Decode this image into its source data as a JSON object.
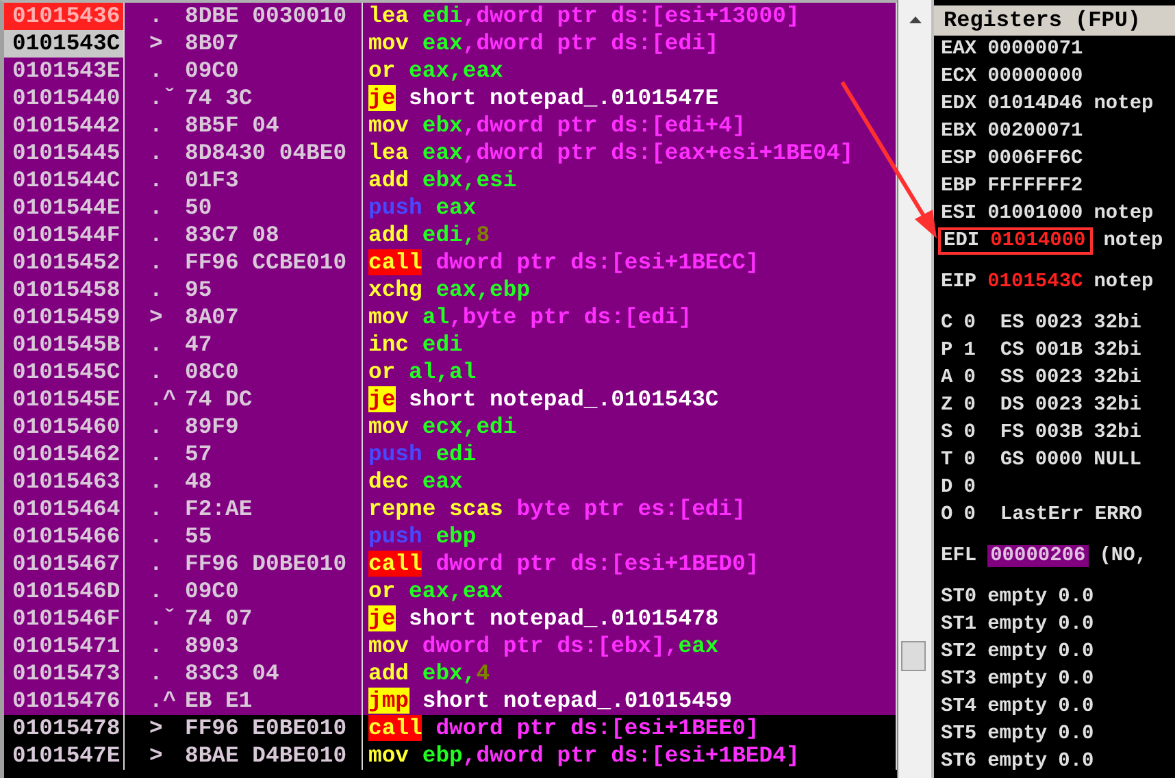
{
  "disassembly": {
    "rows": [
      {
        "address": "01015436",
        "breakpoint": true,
        "eip": false,
        "selected": true,
        "marker": ".",
        "hex": "8DBE 0030010",
        "mnemonic": {
          "text": "lea",
          "kind": "plain"
        },
        "operands": [
          {
            "text": "edi",
            "kind": "register"
          },
          {
            "text": ",dword ptr ds:[esi+13000]",
            "kind": "memory"
          }
        ]
      },
      {
        "address": "0101543C",
        "breakpoint": false,
        "eip": true,
        "selected": true,
        "marker": ">",
        "hex": "8B07",
        "mnemonic": {
          "text": "mov",
          "kind": "plain"
        },
        "operands": [
          {
            "text": "eax",
            "kind": "register"
          },
          {
            "text": ",dword ptr ds:[edi]",
            "kind": "memory"
          }
        ]
      },
      {
        "address": "0101543E",
        "breakpoint": false,
        "eip": false,
        "selected": true,
        "marker": ".",
        "hex": "09C0",
        "mnemonic": {
          "text": "or",
          "kind": "plain"
        },
        "operands": [
          {
            "text": "eax,eax",
            "kind": "register"
          }
        ]
      },
      {
        "address": "01015440",
        "breakpoint": false,
        "eip": false,
        "selected": true,
        "marker": ".ˇ",
        "hex": "74 3C",
        "mnemonic": {
          "text": "je",
          "kind": "jump"
        },
        "operands": [
          {
            "text": "short notepad_.0101547E",
            "kind": "label"
          }
        ]
      },
      {
        "address": "01015442",
        "breakpoint": false,
        "eip": false,
        "selected": true,
        "marker": ".",
        "hex": "8B5F 04",
        "mnemonic": {
          "text": "mov",
          "kind": "plain"
        },
        "operands": [
          {
            "text": "ebx",
            "kind": "register"
          },
          {
            "text": ",dword ptr ds:[edi+4]",
            "kind": "memory"
          }
        ]
      },
      {
        "address": "01015445",
        "breakpoint": false,
        "eip": false,
        "selected": true,
        "marker": ".",
        "hex": "8D8430 04BE0",
        "mnemonic": {
          "text": "lea",
          "kind": "plain"
        },
        "operands": [
          {
            "text": "eax",
            "kind": "register"
          },
          {
            "text": ",dword ptr ds:[eax+esi+1BE04]",
            "kind": "memory"
          }
        ]
      },
      {
        "address": "0101544C",
        "breakpoint": false,
        "eip": false,
        "selected": true,
        "marker": ".",
        "hex": "01F3",
        "mnemonic": {
          "text": "add",
          "kind": "plain"
        },
        "operands": [
          {
            "text": "ebx,esi",
            "kind": "register"
          }
        ]
      },
      {
        "address": "0101544E",
        "breakpoint": false,
        "eip": false,
        "selected": true,
        "marker": ".",
        "hex": "50",
        "mnemonic": {
          "text": "push",
          "kind": "push"
        },
        "operands": [
          {
            "text": "eax",
            "kind": "register"
          }
        ]
      },
      {
        "address": "0101544F",
        "breakpoint": false,
        "eip": false,
        "selected": true,
        "marker": ".",
        "hex": "83C7 08",
        "mnemonic": {
          "text": "add",
          "kind": "plain"
        },
        "operands": [
          {
            "text": "edi,",
            "kind": "register"
          },
          {
            "text": "8",
            "kind": "constant"
          }
        ]
      },
      {
        "address": "01015452",
        "breakpoint": false,
        "eip": false,
        "selected": true,
        "marker": ".",
        "hex": "FF96 CCBE010",
        "mnemonic": {
          "text": "call",
          "kind": "call"
        },
        "operands": [
          {
            "text": "dword ptr ds:[esi+1BECC]",
            "kind": "memory"
          }
        ]
      },
      {
        "address": "01015458",
        "breakpoint": false,
        "eip": false,
        "selected": true,
        "marker": ".",
        "hex": "95",
        "mnemonic": {
          "text": "xchg",
          "kind": "plain"
        },
        "operands": [
          {
            "text": "eax,ebp",
            "kind": "register"
          }
        ]
      },
      {
        "address": "01015459",
        "breakpoint": false,
        "eip": false,
        "selected": true,
        "marker": ">",
        "hex": "8A07",
        "mnemonic": {
          "text": "mov",
          "kind": "plain"
        },
        "operands": [
          {
            "text": "al",
            "kind": "register"
          },
          {
            "text": ",byte ptr ds:[edi]",
            "kind": "memory"
          }
        ]
      },
      {
        "address": "0101545B",
        "breakpoint": false,
        "eip": false,
        "selected": true,
        "marker": ".",
        "hex": "47",
        "mnemonic": {
          "text": "inc",
          "kind": "plain"
        },
        "operands": [
          {
            "text": "edi",
            "kind": "register"
          }
        ]
      },
      {
        "address": "0101545C",
        "breakpoint": false,
        "eip": false,
        "selected": true,
        "marker": ".",
        "hex": "08C0",
        "mnemonic": {
          "text": "or",
          "kind": "plain"
        },
        "operands": [
          {
            "text": "al,al",
            "kind": "register"
          }
        ]
      },
      {
        "address": "0101545E",
        "breakpoint": false,
        "eip": false,
        "selected": true,
        "marker": ".^",
        "hex": "74 DC",
        "mnemonic": {
          "text": "je",
          "kind": "jump"
        },
        "operands": [
          {
            "text": "short notepad_.0101543C",
            "kind": "label"
          }
        ]
      },
      {
        "address": "01015460",
        "breakpoint": false,
        "eip": false,
        "selected": true,
        "marker": ".",
        "hex": "89F9",
        "mnemonic": {
          "text": "mov",
          "kind": "plain"
        },
        "operands": [
          {
            "text": "ecx,edi",
            "kind": "register"
          }
        ]
      },
      {
        "address": "01015462",
        "breakpoint": false,
        "eip": false,
        "selected": true,
        "marker": ".",
        "hex": "57",
        "mnemonic": {
          "text": "push",
          "kind": "push"
        },
        "operands": [
          {
            "text": "edi",
            "kind": "register"
          }
        ]
      },
      {
        "address": "01015463",
        "breakpoint": false,
        "eip": false,
        "selected": true,
        "marker": ".",
        "hex": "48",
        "mnemonic": {
          "text": "dec",
          "kind": "plain"
        },
        "operands": [
          {
            "text": "eax",
            "kind": "register"
          }
        ]
      },
      {
        "address": "01015464",
        "breakpoint": false,
        "eip": false,
        "selected": true,
        "marker": ".",
        "hex": "F2:AE",
        "mnemonic": {
          "text": "repne scas",
          "kind": "plain"
        },
        "operands": [
          {
            "text": "byte ptr es:[edi]",
            "kind": "memory"
          }
        ]
      },
      {
        "address": "01015466",
        "breakpoint": false,
        "eip": false,
        "selected": true,
        "marker": ".",
        "hex": "55",
        "mnemonic": {
          "text": "push",
          "kind": "push"
        },
        "operands": [
          {
            "text": "ebp",
            "kind": "register"
          }
        ]
      },
      {
        "address": "01015467",
        "breakpoint": false,
        "eip": false,
        "selected": true,
        "marker": ".",
        "hex": "FF96 D0BE010",
        "mnemonic": {
          "text": "call",
          "kind": "call"
        },
        "operands": [
          {
            "text": "dword ptr ds:[esi+1BED0]",
            "kind": "memory"
          }
        ]
      },
      {
        "address": "0101546D",
        "breakpoint": false,
        "eip": false,
        "selected": true,
        "marker": ".",
        "hex": "09C0",
        "mnemonic": {
          "text": "or",
          "kind": "plain"
        },
        "operands": [
          {
            "text": "eax,eax",
            "kind": "register"
          }
        ]
      },
      {
        "address": "0101546F",
        "breakpoint": false,
        "eip": false,
        "selected": true,
        "marker": ".ˇ",
        "hex": "74 07",
        "mnemonic": {
          "text": "je",
          "kind": "jump"
        },
        "operands": [
          {
            "text": "short notepad_.01015478",
            "kind": "label"
          }
        ]
      },
      {
        "address": "01015471",
        "breakpoint": false,
        "eip": false,
        "selected": true,
        "marker": ".",
        "hex": "8903",
        "mnemonic": {
          "text": "mov",
          "kind": "plain"
        },
        "operands": [
          {
            "text": "dword ptr ds:[ebx],",
            "kind": "memory"
          },
          {
            "text": "eax",
            "kind": "register"
          }
        ]
      },
      {
        "address": "01015473",
        "breakpoint": false,
        "eip": false,
        "selected": true,
        "marker": ".",
        "hex": "83C3 04",
        "mnemonic": {
          "text": "add",
          "kind": "plain"
        },
        "operands": [
          {
            "text": "ebx,",
            "kind": "register"
          },
          {
            "text": "4",
            "kind": "constant"
          }
        ]
      },
      {
        "address": "01015476",
        "breakpoint": false,
        "eip": false,
        "selected": true,
        "marker": ".^",
        "hex": "EB E1",
        "mnemonic": {
          "text": "jmp",
          "kind": "jump"
        },
        "operands": [
          {
            "text": "short notepad_.01015459",
            "kind": "label"
          }
        ]
      },
      {
        "address": "01015478",
        "breakpoint": false,
        "eip": false,
        "selected": false,
        "marker": ">",
        "hex": "FF96 E0BE010",
        "mnemonic": {
          "text": "call",
          "kind": "call"
        },
        "operands": [
          {
            "text": "dword ptr ds:[esi+1BEE0]",
            "kind": "memory"
          }
        ]
      },
      {
        "address": "0101547E",
        "breakpoint": false,
        "eip": false,
        "selected": false,
        "marker": ">",
        "hex": "8BAE D4BE010",
        "mnemonic": {
          "text": "mov",
          "kind": "plain"
        },
        "operands": [
          {
            "text": "ebp",
            "kind": "register"
          },
          {
            "text": ",dword ptr ds:[esi+1BED4]",
            "kind": "memory"
          }
        ]
      }
    ]
  },
  "registers": {
    "title": "Registers (FPU)",
    "sections": [
      {
        "lines": [
          {
            "kind": "reg",
            "name": "EAX",
            "value": "00000071",
            "changed": false,
            "highlighted": false
          },
          {
            "kind": "reg",
            "name": "ECX",
            "value": "00000000",
            "changed": false,
            "highlighted": false
          },
          {
            "kind": "reg",
            "name": "EDX",
            "value": "01014D46",
            "changed": false,
            "highlighted": false,
            "comment": "notep"
          },
          {
            "kind": "reg",
            "name": "EBX",
            "value": "00200071",
            "changed": false,
            "highlighted": false
          },
          {
            "kind": "reg",
            "name": "ESP",
            "value": "0006FF6C",
            "changed": false,
            "highlighted": false
          },
          {
            "kind": "reg",
            "name": "EBP",
            "value": "FFFFFFF2",
            "changed": false,
            "highlighted": false
          },
          {
            "kind": "reg",
            "name": "ESI",
            "value": "01001000",
            "changed": false,
            "highlighted": false,
            "comment": "notep"
          },
          {
            "kind": "reg",
            "name": "EDI",
            "value": "01014000",
            "changed": true,
            "highlighted": true,
            "comment": "notep"
          }
        ]
      },
      {
        "lines": [
          {
            "kind": "reg",
            "name": "EIP",
            "value": "0101543C",
            "changed": true,
            "highlighted": false,
            "comment": "notep"
          }
        ]
      },
      {
        "lines": [
          {
            "kind": "flag",
            "flag": "C",
            "bit": "0",
            "segment": "ES",
            "selector": "0023",
            "note": "32bi"
          },
          {
            "kind": "flag",
            "flag": "P",
            "bit": "1",
            "segment": "CS",
            "selector": "001B",
            "note": "32bi"
          },
          {
            "kind": "flag",
            "flag": "A",
            "bit": "0",
            "segment": "SS",
            "selector": "0023",
            "note": "32bi"
          },
          {
            "kind": "flag",
            "flag": "Z",
            "bit": "0",
            "segment": "DS",
            "selector": "0023",
            "note": "32bi"
          },
          {
            "kind": "flag",
            "flag": "S",
            "bit": "0",
            "segment": "FS",
            "selector": "003B",
            "note": "32bi"
          },
          {
            "kind": "flag",
            "flag": "T",
            "bit": "0",
            "segment": "GS",
            "selector": "0000",
            "note": "NULL"
          },
          {
            "kind": "flag",
            "flag": "D",
            "bit": "0"
          },
          {
            "kind": "flag",
            "flag": "O",
            "bit": "0",
            "segment": "LastErr",
            "note": "ERRO"
          }
        ]
      },
      {
        "lines": [
          {
            "kind": "efl",
            "name": "EFL",
            "value": "00000206",
            "comment": "(NO,"
          }
        ]
      },
      {
        "lines": [
          {
            "kind": "fpu",
            "name": "ST0",
            "tag": "empty",
            "value": "0.0"
          },
          {
            "kind": "fpu",
            "name": "ST1",
            "tag": "empty",
            "value": "0.0"
          },
          {
            "kind": "fpu",
            "name": "ST2",
            "tag": "empty",
            "value": "0.0"
          },
          {
            "kind": "fpu",
            "name": "ST3",
            "tag": "empty",
            "value": "0.0"
          },
          {
            "kind": "fpu",
            "name": "ST4",
            "tag": "empty",
            "value": "0.0"
          },
          {
            "kind": "fpu",
            "name": "ST5",
            "tag": "empty",
            "value": "0.0"
          },
          {
            "kind": "fpu",
            "name": "ST6",
            "tag": "empty",
            "value": "0.0"
          }
        ]
      }
    ]
  }
}
